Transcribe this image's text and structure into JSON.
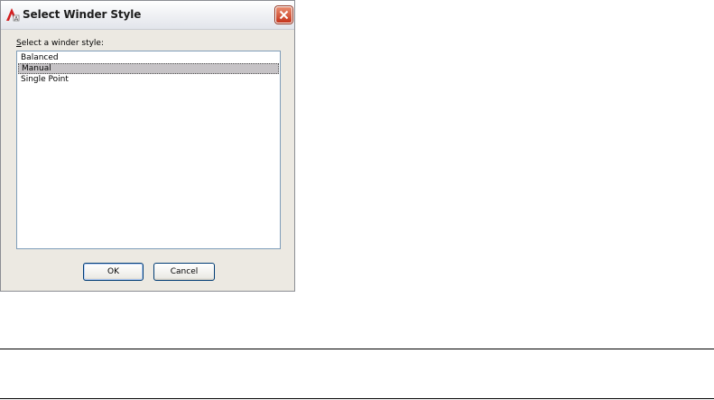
{
  "dialog": {
    "title": "Select Winder Style",
    "prompt_mnemonic": "S",
    "prompt_rest": "elect a winder style:",
    "items": [
      {
        "label": "Balanced",
        "selected": false
      },
      {
        "label": "Manual",
        "selected": true
      },
      {
        "label": "Single Point",
        "selected": false
      }
    ],
    "ok_label": "OK",
    "cancel_label": "Cancel"
  },
  "icons": {
    "app": "autocad-app-icon",
    "close": "close-icon"
  },
  "colors": {
    "dialog_bg": "#ece9e2",
    "selection_bg": "#c6c3c6",
    "close_red": "#c5341c",
    "list_border": "#7f9db9"
  }
}
